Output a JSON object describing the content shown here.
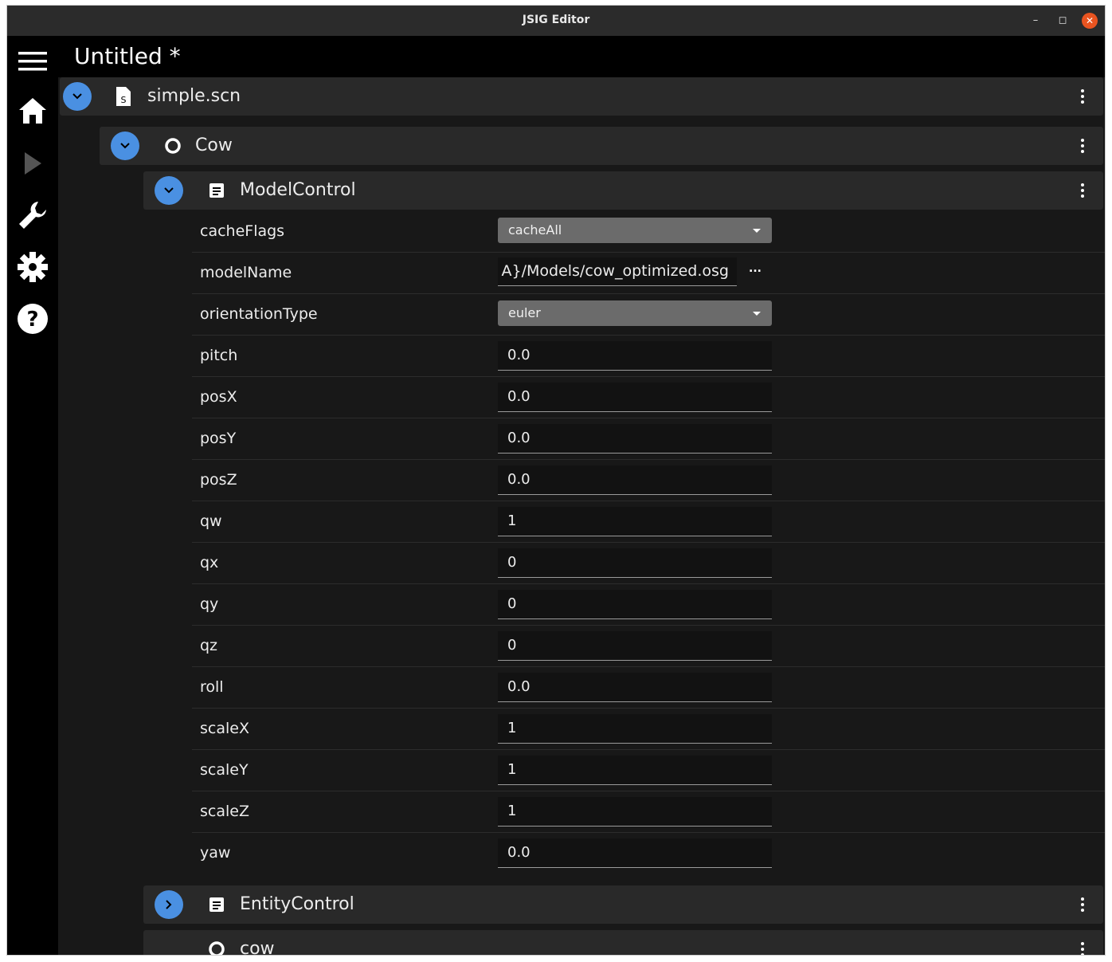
{
  "window": {
    "title": "JSIG Editor"
  },
  "header": {
    "doc_title": "Untitled *"
  },
  "sidebar": {
    "items": [
      "menu-icon",
      "home-icon",
      "play-icon",
      "wrench-icon",
      "gear-icon",
      "help-icon"
    ]
  },
  "tree": {
    "file": {
      "label": "simple.scn",
      "icon": "script-file-icon"
    },
    "entity": {
      "label": "Cow",
      "icon": "circle-icon"
    },
    "component": {
      "label": "ModelControl",
      "icon": "document-icon"
    },
    "properties": [
      {
        "name": "cacheFlags",
        "kind": "select",
        "value": "cacheAll"
      },
      {
        "name": "modelName",
        "kind": "file",
        "value": "A}/Models/cow_optimized.osg",
        "browse": "..."
      },
      {
        "name": "orientationType",
        "kind": "select",
        "value": "euler"
      },
      {
        "name": "pitch",
        "kind": "text",
        "value": "0.0"
      },
      {
        "name": "posX",
        "kind": "text",
        "value": "0.0"
      },
      {
        "name": "posY",
        "kind": "text",
        "value": "0.0"
      },
      {
        "name": "posZ",
        "kind": "text",
        "value": "0.0"
      },
      {
        "name": "qw",
        "kind": "text",
        "value": "1"
      },
      {
        "name": "qx",
        "kind": "text",
        "value": "0"
      },
      {
        "name": "qy",
        "kind": "text",
        "value": "0"
      },
      {
        "name": "qz",
        "kind": "text",
        "value": "0"
      },
      {
        "name": "roll",
        "kind": "text",
        "value": "0.0"
      },
      {
        "name": "scaleX",
        "kind": "text",
        "value": "1"
      },
      {
        "name": "scaleY",
        "kind": "text",
        "value": "1"
      },
      {
        "name": "scaleZ",
        "kind": "text",
        "value": "1"
      },
      {
        "name": "yaw",
        "kind": "text",
        "value": "0.0"
      }
    ],
    "component2": {
      "label": "EntityControl",
      "icon": "document-icon"
    },
    "entity2": {
      "label": "cow",
      "icon": "circle-icon"
    }
  },
  "colors": {
    "accent": "#4a90e2",
    "background": "#181818",
    "row": "#292929"
  }
}
